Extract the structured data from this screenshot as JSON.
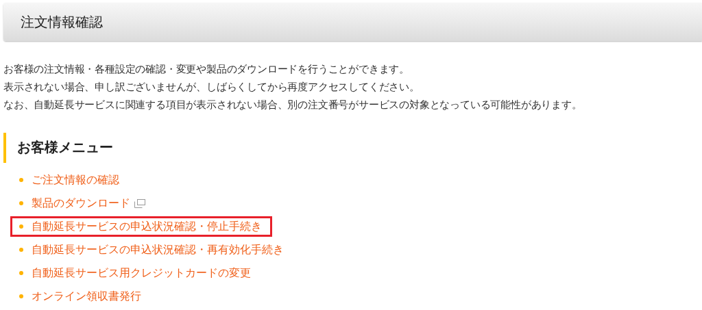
{
  "header": {
    "title": "注文情報確認"
  },
  "intro": [
    "お客様の注文情報・各種設定の確認・変更や製品のダウンロードを行うことができます。",
    "表示されない場合、申し訳ございませんが、しばらくしてから再度アクセスしてください。",
    "なお、自動延長サービスに関連する項目が表示されない場合、別の注文番号がサービスの対象となっている可能性があります。"
  ],
  "menu": {
    "heading": "お客様メニュー",
    "items": [
      {
        "label": "ご注文情報の確認",
        "external": false,
        "highlighted": false
      },
      {
        "label": "製品のダウンロード",
        "external": true,
        "highlighted": false
      },
      {
        "label": "自動延長サービスの申込状況確認・停止手続き",
        "external": false,
        "highlighted": true
      },
      {
        "label": "自動延長サービスの申込状況確認・再有効化手続き",
        "external": false,
        "highlighted": false
      },
      {
        "label": "自動延長サービス用クレジットカードの変更",
        "external": false,
        "highlighted": false
      },
      {
        "label": "オンライン領収書発行",
        "external": false,
        "highlighted": false
      }
    ]
  }
}
